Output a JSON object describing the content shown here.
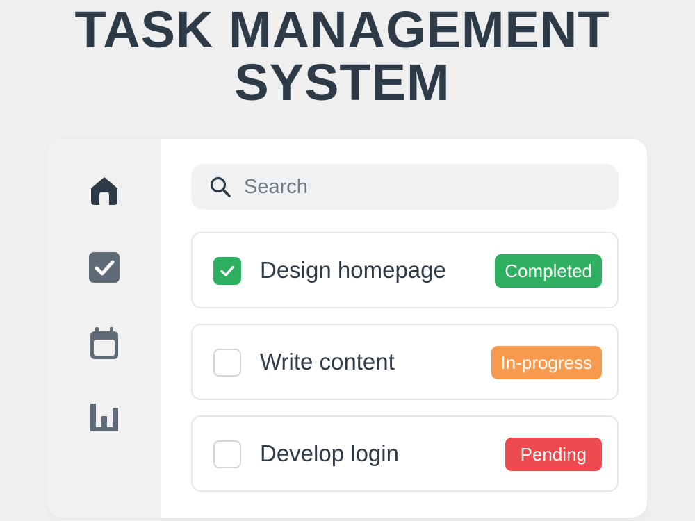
{
  "title": {
    "line1": "TASK MANAGEMENT",
    "line2": "SYSTEM"
  },
  "sidebar": {
    "items": [
      {
        "icon": "home-icon"
      },
      {
        "icon": "checkbox-icon"
      },
      {
        "icon": "calendar-icon"
      },
      {
        "icon": "chart-icon"
      }
    ]
  },
  "search": {
    "placeholder": "Search",
    "value": "",
    "icon": "search-icon"
  },
  "tasks": [
    {
      "label": "Design homepage",
      "checked": true,
      "status": "Completed",
      "status_color": "#2fb061"
    },
    {
      "label": "Write content",
      "checked": false,
      "status": "In-progress",
      "status_color": "#f79a4e"
    },
    {
      "label": "Develop login",
      "checked": false,
      "status": "Pending",
      "status_color": "#ec4a4f"
    }
  ],
  "colors": {
    "background": "#efeff0",
    "text": "#2d3a48",
    "sidebar": "#f1f1f2",
    "icon": "#2d3a48",
    "icon_muted": "#5f6b77"
  }
}
